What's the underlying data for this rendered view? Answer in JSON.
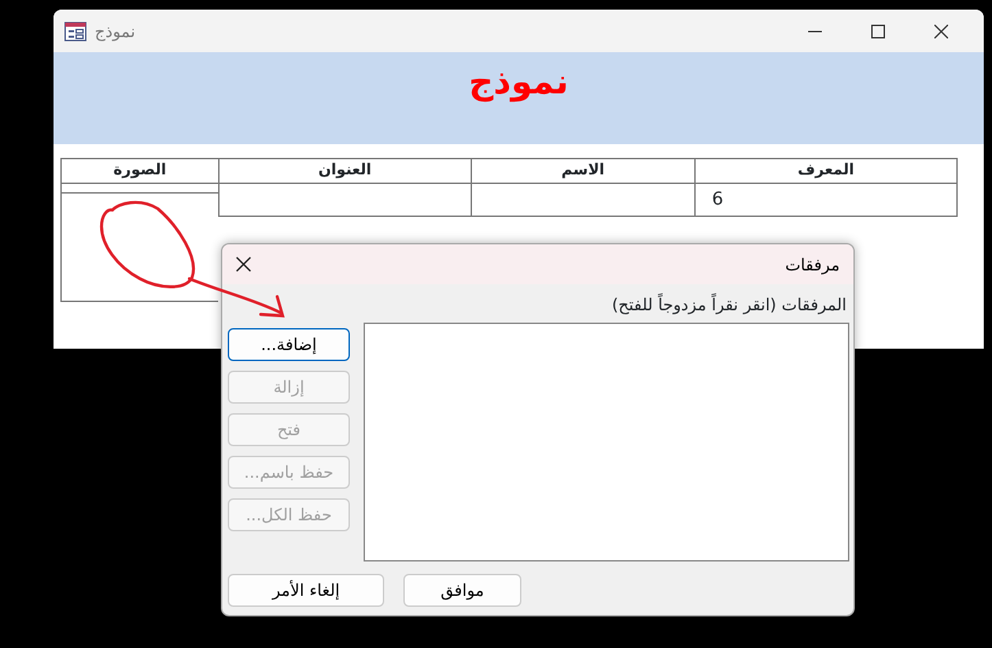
{
  "window": {
    "title": "نموذج",
    "header": "نموذج"
  },
  "table": {
    "columns": [
      "المعرف",
      "الاسم",
      "العنوان",
      "الصورة"
    ],
    "rows": [
      {
        "id": "6"
      }
    ]
  },
  "dialog": {
    "title": "مرفقات",
    "label": "المرفقات (انقر نقراً مزدوجاً للفتح)",
    "side_buttons": [
      {
        "label": "إضافة...",
        "disabled": false,
        "focused": true
      },
      {
        "label": "إزالة",
        "disabled": true,
        "focused": false
      },
      {
        "label": "فتح",
        "disabled": true,
        "focused": false
      },
      {
        "label": "حفظ باسم...",
        "disabled": true,
        "focused": false
      },
      {
        "label": "حفظ الكل...",
        "disabled": true,
        "focused": false
      }
    ],
    "buttons": [
      "موافق",
      "إلغاء الأمر"
    ]
  }
}
